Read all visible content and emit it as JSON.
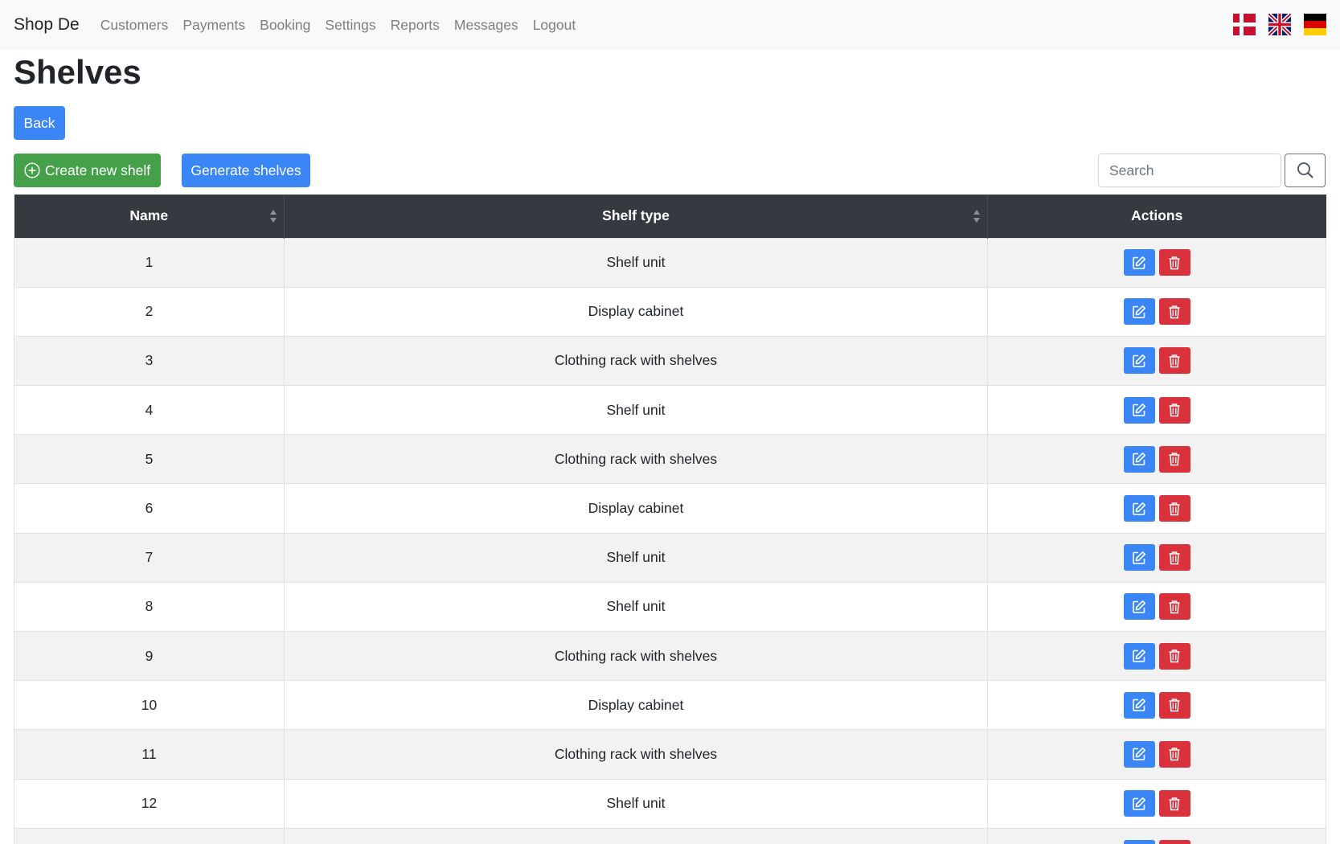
{
  "navbar": {
    "brand": "Shop De",
    "links": [
      "Customers",
      "Payments",
      "Booking",
      "Settings",
      "Reports",
      "Messages",
      "Logout"
    ],
    "flags": [
      "danish-flag-icon",
      "uk-flag-icon",
      "german-flag-icon"
    ]
  },
  "page": {
    "title": "Shelves",
    "back_label": "Back",
    "create_label": "Create new shelf",
    "generate_label": "Generate shelves"
  },
  "search": {
    "placeholder": "Search",
    "value": ""
  },
  "table": {
    "headers": [
      "Name",
      "Shelf type",
      "Actions"
    ],
    "rows": [
      {
        "name": "1",
        "type": "Shelf unit"
      },
      {
        "name": "2",
        "type": "Display cabinet"
      },
      {
        "name": "3",
        "type": "Clothing rack with shelves"
      },
      {
        "name": "4",
        "type": "Shelf unit"
      },
      {
        "name": "5",
        "type": "Clothing rack with shelves"
      },
      {
        "name": "6",
        "type": "Display cabinet"
      },
      {
        "name": "7",
        "type": "Shelf unit"
      },
      {
        "name": "8",
        "type": "Shelf unit"
      },
      {
        "name": "9",
        "type": "Clothing rack with shelves"
      },
      {
        "name": "10",
        "type": "Display cabinet"
      },
      {
        "name": "11",
        "type": "Clothing rack with shelves"
      },
      {
        "name": "12",
        "type": "Shelf unit"
      },
      {
        "name": "",
        "type": ""
      }
    ]
  },
  "colors": {
    "primary": "#3b86f7",
    "success": "#45a149",
    "danger": "#d9323c",
    "header_dark": "#343a40"
  }
}
